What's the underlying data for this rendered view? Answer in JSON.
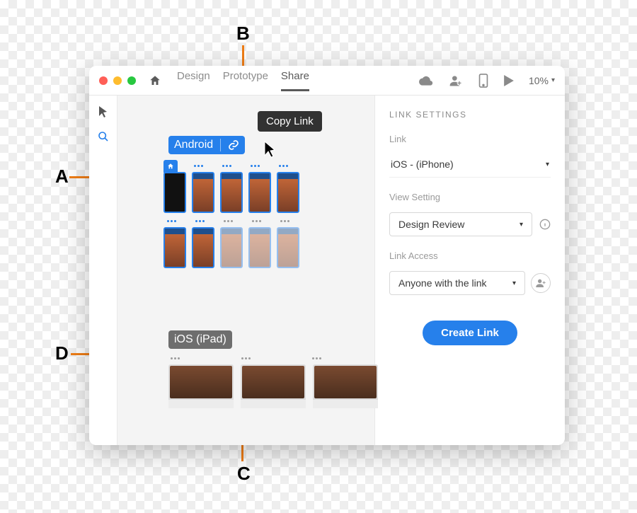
{
  "annotations": {
    "a": "A",
    "b": "B",
    "c": "C",
    "d": "D"
  },
  "titlebar": {
    "tabs": {
      "design": "Design",
      "prototype": "Prototype",
      "share": "Share"
    },
    "zoom": "10%"
  },
  "canvas": {
    "flow1_label": "Android",
    "tooltip": "Copy Link",
    "flow2_label": "iOS (iPad)"
  },
  "panel": {
    "title": "LINK SETTINGS",
    "link_label": "Link",
    "link_value": "iOS - (iPhone)",
    "view_label": "View Setting",
    "view_value": "Design Review",
    "access_label": "Link Access",
    "access_value": "Anyone with the link",
    "create_btn": "Create Link"
  }
}
